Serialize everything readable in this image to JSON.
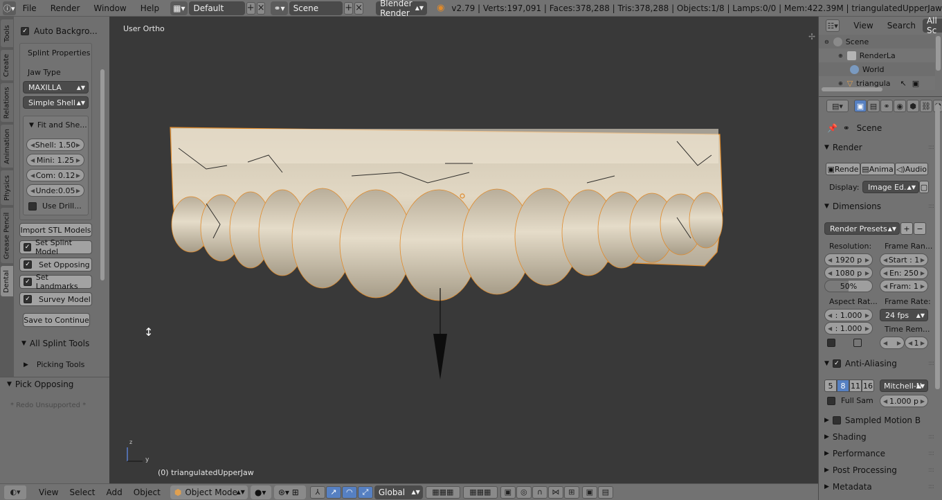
{
  "topbar": {
    "info_icon": "info-icon",
    "menus": [
      "File",
      "Render",
      "Window",
      "Help"
    ],
    "screen_layout": "Default",
    "scene": "Scene",
    "engine": "Blender Render",
    "stats": "v2.79 | Verts:197,091 | Faces:378,288 | Tris:378,288 | Objects:1/8 | Lamps:0/0 | Mem:422.39M | triangulatedUpperJaw"
  },
  "tabs": [
    "Tools",
    "Create",
    "Relations",
    "Animation",
    "Physics",
    "Grease Pencil",
    "Dental"
  ],
  "shelf": {
    "auto_background": "Auto Backgro...",
    "splint_properties": "Splint Properties",
    "jaw_type_label": "Jaw Type",
    "jaw_type": "MAXILLA",
    "shell_type": "Simple Shell",
    "fit_panel": "Fit and She...",
    "shell": "Shell: 1.50",
    "mini": "Mini: 1.25",
    "com": "Com: 0.12",
    "unde": "Unde:0.05",
    "use_drill": "Use Drill...",
    "import_stl": "Import STL Models",
    "set_splint": "Set Splint Model",
    "set_opposing": "Set Opposing",
    "set_landmarks": "Set Landmarks",
    "survey_model": "Survey Model",
    "save_continue": "Save to Continue",
    "all_splint_tools": "All Splint Tools",
    "picking_tools": "Picking Tools"
  },
  "operator": {
    "title": "Pick Opposing",
    "redo": "* Redo Unsupported *"
  },
  "viewport": {
    "view_name": "User Ortho",
    "object_label": "(0) triangulatedUpperJaw",
    "axis_z": "z",
    "axis_y": "y"
  },
  "bottombar": {
    "menus": [
      "View",
      "Select",
      "Add",
      "Object"
    ],
    "mode": "Object Mode",
    "orientation": "Global"
  },
  "outliner": {
    "view": "View",
    "search": "Search",
    "filter": "All Sc",
    "rows": [
      "Scene",
      "RenderLa",
      "World",
      "triangula"
    ]
  },
  "properties": {
    "context": "Scene",
    "render_section": "Render",
    "render_btn": "Rende",
    "anim_btn": "Anima",
    "audio_btn": "Audio",
    "display_label": "Display:",
    "display_value": "Image Ed...",
    "dimensions_section": "Dimensions",
    "render_presets": "Render Presets",
    "resolution_label": "Resolution:",
    "res_x": "1920 p",
    "res_y": "1080 p",
    "res_pct": "50%",
    "frame_range_label": "Frame Ran...",
    "frame_start": "Start : 1",
    "frame_end": "En: 250",
    "frame_step": "Fram: 1",
    "aspect_label": "Aspect Rat...",
    "aspect_x": ": 1.000",
    "aspect_y": ": 1.000",
    "frame_rate_label": "Frame Rate:",
    "frame_rate": "24 fps",
    "time_remap_label": "Time Rem...",
    "time_remap_val": "1",
    "aa_section": "Anti-Aliasing",
    "aa_samples": [
      "5",
      "8",
      "11",
      "16"
    ],
    "aa_filter": "Mitchell-N",
    "full_sample": "Full Sam",
    "filter_size": "1.000 p",
    "motion_blur": "Sampled Motion Blur",
    "shading": "Shading",
    "performance": "Performance",
    "post_processing": "Post Processing",
    "metadata": "Metadata"
  }
}
